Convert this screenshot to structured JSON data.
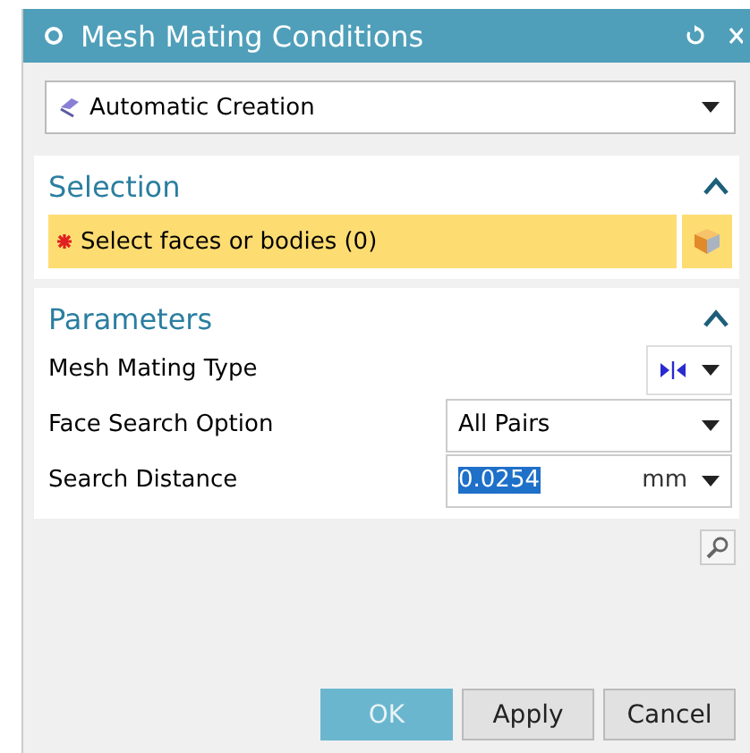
{
  "window": {
    "title": "Mesh Mating Conditions"
  },
  "type_dropdown": {
    "value": "Automatic Creation"
  },
  "sections": [
    {
      "kind": "selection",
      "title": "Selection",
      "expanded": true,
      "prompt": "Select faces or bodies (0)",
      "required": true
    },
    {
      "kind": "parameters",
      "title": "Parameters",
      "expanded": true,
      "rows": [
        {
          "kind": "icon-dropdown",
          "label": "Mesh Mating Type"
        },
        {
          "kind": "dropdown",
          "label": "Face Search Option",
          "value": "All Pairs"
        },
        {
          "kind": "number",
          "label": "Search Distance",
          "value": "0.0254",
          "value_selected": true,
          "unit": "mm"
        }
      ]
    }
  ],
  "buttons": [
    {
      "label": "OK",
      "kind": "primary"
    },
    {
      "label": "Apply",
      "kind": "normal"
    },
    {
      "label": "Cancel",
      "kind": "normal"
    }
  ]
}
